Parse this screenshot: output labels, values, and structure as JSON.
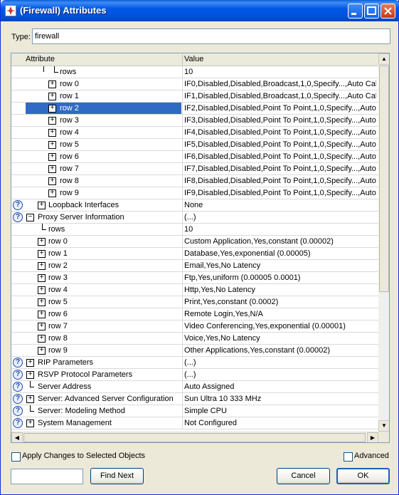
{
  "window": {
    "title": "(Firewall) Attributes"
  },
  "type_field": {
    "label": "Type:",
    "value": "firewall"
  },
  "grid": {
    "headers": {
      "attribute": "Attribute",
      "value": "Value"
    },
    "rows": [
      {
        "name": "rows",
        "value": "10"
      },
      {
        "name": "row 0",
        "value": "IF0,Disabled,Disabled,Broadcast,1,0,Specify...,Auto Cal..."
      },
      {
        "name": "row 1",
        "value": "IF1,Disabled,Disabled,Broadcast,1,0,Specify...,Auto Cal..."
      },
      {
        "name": "row 2",
        "value": "IF2,Disabled,Disabled,Point To Point,1,0,Specify...,Auto..."
      },
      {
        "name": "row 3",
        "value": "IF3,Disabled,Disabled,Point To Point,1,0,Specify...,Auto..."
      },
      {
        "name": "row 4",
        "value": "IF4,Disabled,Disabled,Point To Point,1,0,Specify...,Auto..."
      },
      {
        "name": "row 5",
        "value": "IF5,Disabled,Disabled,Point To Point,1,0,Specify...,Auto..."
      },
      {
        "name": "row 6",
        "value": "IF6,Disabled,Disabled,Point To Point,1,0,Specify...,Auto..."
      },
      {
        "name": "row 7",
        "value": "IF7,Disabled,Disabled,Point To Point,1,0,Specify...,Auto..."
      },
      {
        "name": "row 8",
        "value": "IF8,Disabled,Disabled,Point To Point,1,0,Specify...,Auto..."
      },
      {
        "name": "row 9",
        "value": "IF9,Disabled,Disabled,Point To Point,1,0,Specify...,Auto..."
      },
      {
        "name": "Loopback Interfaces",
        "value": "None"
      },
      {
        "name": "Proxy Server Information",
        "value": "(...)"
      },
      {
        "name": "rows",
        "value": "10"
      },
      {
        "name": "row 0",
        "value": "Custom Application,Yes,constant (0.00002)"
      },
      {
        "name": "row 1",
        "value": "Database,Yes,exponential (0.00005)"
      },
      {
        "name": "row 2",
        "value": "Email,Yes,No Latency"
      },
      {
        "name": "row 3",
        "value": "Ftp,Yes,uniform (0.00005 0.0001)"
      },
      {
        "name": "row 4",
        "value": "Http,Yes,No Latency"
      },
      {
        "name": "row 5",
        "value": "Print,Yes,constant (0.0002)"
      },
      {
        "name": "row 6",
        "value": "Remote Login,Yes,N/A"
      },
      {
        "name": "row 7",
        "value": "Video Conferencing,Yes,exponential (0.00001)"
      },
      {
        "name": "row 8",
        "value": "Voice,Yes,No Latency"
      },
      {
        "name": "row 9",
        "value": "Other Applications,Yes,constant (0.00002)"
      },
      {
        "name": "RIP Parameters",
        "value": "(...)"
      },
      {
        "name": "RSVP Protocol Parameters",
        "value": "(...)"
      },
      {
        "name": "Server Address",
        "value": "Auto Assigned"
      },
      {
        "name": "Server: Advanced Server Configuration",
        "value": "Sun Ultra 10 333 MHz"
      },
      {
        "name": "Server: Modeling Method",
        "value": "Simple CPU"
      },
      {
        "name": "System Management",
        "value": "Not Configured"
      }
    ]
  },
  "footer": {
    "apply_label": "Apply Changes to Selected Objects",
    "advanced_label": "Advanced",
    "search_value": "",
    "find_next_label": "Find Next",
    "cancel_label": "Cancel",
    "ok_label": "OK"
  },
  "icons": {
    "help": "question-icon",
    "expand": "plus-icon",
    "collapse": "minus-icon",
    "scroll_up": "up-arrow-icon",
    "scroll_down": "down-arrow-icon",
    "scroll_left": "left-arrow-icon",
    "scroll_right": "right-arrow-icon"
  },
  "colors": {
    "selection": "#316ac5",
    "titlebar": "#0058e6"
  }
}
